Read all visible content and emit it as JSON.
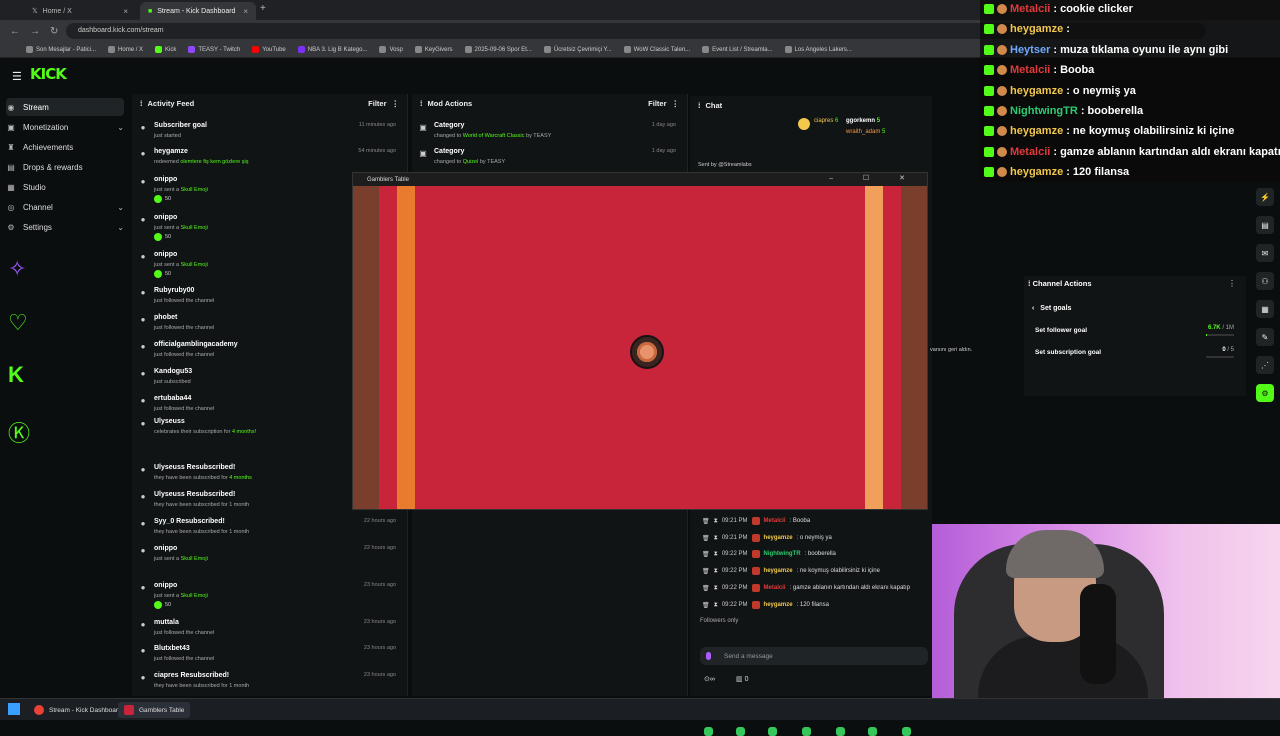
{
  "browser": {
    "tabs": [
      {
        "label": "Home / X",
        "close": "×"
      },
      {
        "label": "Stream - Kick Dashboard",
        "close": "×"
      }
    ],
    "new_tab": "+",
    "url": "dashboard.kick.com/stream",
    "bookmarks": [
      "Son Mesajlar - Patici...",
      "Home / X",
      "Kick",
      "TEASY - Twitch",
      "YouTube",
      "NBA 3. Lig B Katego...",
      "Vosp",
      "KeyGivers",
      "2025-09-06 Spor Et...",
      "Ücretsiz Çevrimiçi Y...",
      "WoW Classic Talen...",
      "Event List / Streamla...",
      "Los Angeles Lakers..."
    ]
  },
  "kick": {
    "logo": "KICK",
    "nav": [
      {
        "label": "Stream",
        "icon": "stream-icon",
        "active": true
      },
      {
        "label": "Monetization",
        "chevron": true
      },
      {
        "label": "Achievements"
      },
      {
        "label": "Drops & rewards"
      },
      {
        "label": "Studio"
      },
      {
        "label": "Channel",
        "chevron": true
      },
      {
        "label": "Settings",
        "chevron": true
      }
    ]
  },
  "activity": {
    "title": "Activity Feed",
    "filter": "Filter",
    "items": [
      {
        "name": "Subscriber goal",
        "desc": "just started",
        "time": "11 minutes ago"
      },
      {
        "name": "heygamze",
        "desc": "redeemed",
        "hl": "olemtere fiş kem gözlere şiş",
        "time": "54 minutes ago"
      },
      {
        "name": "onippo",
        "desc": "just sent a",
        "hl": "Skull Emoji",
        "badge": "50",
        "time": ""
      },
      {
        "name": "onippo",
        "desc": "just sent a",
        "hl": "Skull Emoji",
        "badge": "50",
        "time": ""
      },
      {
        "name": "onippo",
        "desc": "just sent a",
        "hl": "Skull Emoji",
        "badge": "50",
        "time": ""
      },
      {
        "name": "Rubyruby00",
        "desc": "just followed the channel",
        "time": ""
      },
      {
        "name": "phobet",
        "desc": "just followed the channel",
        "time": ""
      },
      {
        "name": "officialgamblingacademy",
        "desc": "just followed the channel",
        "time": ""
      },
      {
        "name": "Kandogu53",
        "desc": "just subscribed",
        "time": ""
      },
      {
        "name": "ertubaba44",
        "desc": "just followed the channel",
        "time": ""
      },
      {
        "name": "Ulyseuss",
        "desc": "celebrates their subscription for",
        "hl": "4 months!",
        "time": ""
      },
      {
        "name": "Ulyseuss Resubscribed!",
        "desc": "they have been subscribed for",
        "hl": "4 months",
        "time": ""
      },
      {
        "name": "Ulyseuss Resubscribed!",
        "desc": "they have been subscribed for 1 month",
        "time": ""
      },
      {
        "name": "Syy_0 Resubscribed!",
        "desc": "they have been subscribed for 1 month",
        "time": "22 hours ago"
      },
      {
        "name": "onippo",
        "desc": "just sent a",
        "hl": "Skull Emoji",
        "time": "22 hours ago"
      },
      {
        "name": "onippo",
        "desc": "just sent a",
        "hl": "Skull Emoji",
        "badge": "50",
        "time": "23 hours ago"
      },
      {
        "name": "muttala",
        "desc": "just followed the channel",
        "time": "23 hours ago"
      },
      {
        "name": "Blutxbet43",
        "desc": "just followed the channel",
        "time": "23 hours ago"
      },
      {
        "name": "ciapres Resubscribed!",
        "desc": "they have been subscribed for 1 month",
        "time": "23 hours ago"
      }
    ]
  },
  "mod": {
    "title": "Mod Actions",
    "filter": "Filter",
    "items": [
      {
        "name": "Category",
        "desc": "changed to",
        "hl": "World of Warcraft Classic",
        "by": "by TEASY",
        "time": "1 day ago"
      },
      {
        "name": "Category",
        "desc": "changed to",
        "hl": "Quizel",
        "by": "by TEASY",
        "time": "1 day ago"
      }
    ]
  },
  "chat": {
    "title": "Chat",
    "top_users": [
      {
        "name": "ciapres",
        "count": "6"
      },
      {
        "name": "ggorkemn",
        "count": "5"
      },
      {
        "name": "wraith_adam",
        "count": "5"
      }
    ],
    "sent_by": "Sent by",
    "sent_by_user": "@Streamlabs",
    "messages": [
      {
        "time": "09:21 PM",
        "user": "Metalcii",
        "color": "#e23a3a",
        "text": ": Booba"
      },
      {
        "time": "09:21 PM",
        "user": "heygamze",
        "color": "#f2c94c",
        "text": ": o neymiş ya"
      },
      {
        "time": "09:22 PM",
        "user": "NightwingTR",
        "color": "#2ecc71",
        "text": ": booberella"
      },
      {
        "time": "09:22 PM",
        "user": "heygamze",
        "color": "#f2c94c",
        "text": ": ne koymuş olabilirsiniz ki içine"
      },
      {
        "time": "09:22 PM",
        "user": "Metalcii",
        "color": "#e23a3a",
        "text": ": gamze ablanın kartından aldı ekranı kapatıp"
      },
      {
        "time": "09:22 PM",
        "user": "heygamze",
        "color": "#f2c94c",
        "text": ": 120 filansa"
      }
    ],
    "followers_only": "Followers only",
    "placeholder": "Send a message",
    "bottom_count": "0",
    "side_snippet": "varsını geri aldın."
  },
  "game": {
    "title": "Gamblers Table",
    "controls": "– ☐ ✕"
  },
  "channel_actions": {
    "title": "Channel Actions",
    "back": "Set goals",
    "follower_goal_label": "Set follower goal",
    "follower_goal_value": "6.7K",
    "follower_goal_max": " / 1M",
    "follower_goal_progress": 0.0067,
    "sub_goal_label": "Set subscription goal",
    "sub_goal_value": "0",
    "sub_goal_max": " / 5",
    "sub_goal_progress": 0
  },
  "overlay_chat": [
    {
      "user": "Metalcii",
      "color": "#e23a3a",
      "text": ": cookie clicker"
    },
    {
      "user": "heygamze",
      "color": "#f2c94c",
      "text": ": "
    },
    {
      "user": "Heytser",
      "color": "#6fa8ff",
      "text": ": muza tıklama oyunu ile aynı gibi"
    },
    {
      "user": "Metalcii",
      "color": "#e23a3a",
      "text": ": Booba"
    },
    {
      "user": "heygamze",
      "color": "#f2c94c",
      "text": ": o neymiş ya"
    },
    {
      "user": "NightwingTR",
      "color": "#2ecc71",
      "text": ": booberella"
    },
    {
      "user": "heygamze",
      "color": "#f2c94c",
      "text": ": ne koymuş olabilirsiniz ki içine"
    },
    {
      "user": "Metalcii",
      "color": "#e23a3a",
      "text": ": gamze ablanın kartından aldı ekranı kapatıp"
    },
    {
      "user": "heygamze",
      "color": "#f2c94c",
      "text": ": 120 filansa"
    }
  ],
  "taskbar": {
    "items": [
      "Stream - Kick Dashboar...",
      "Gamblers Table"
    ]
  },
  "colors": {
    "kick_green": "#53fc18",
    "game_red": "#c8243a"
  }
}
